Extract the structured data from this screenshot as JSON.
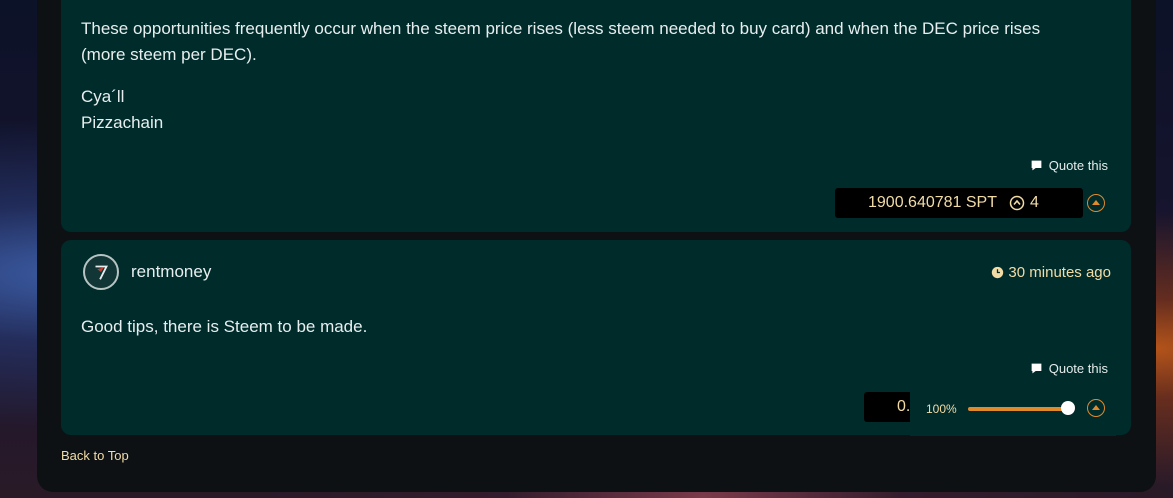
{
  "post1": {
    "paragraph": "These opportunities frequently occur when the steem price rises (less steem needed to buy card) and when the DEC price rises (more steem per DEC).",
    "signoff_line1": "Cya´ll",
    "signoff_line2": "Pizzachain",
    "quote_label": "Quote this",
    "payout": "1900.640781 SPT",
    "votes": "4"
  },
  "post2": {
    "author": "rentmoney",
    "time": "30 minutes ago",
    "body": "Good tips, there is Steem to be made.",
    "quote_label": "Quote this",
    "payout_partial": "0."
  },
  "vote_slider": {
    "percent_label": "100%",
    "value": 1.0
  },
  "footer": {
    "back_to_top": "Back to Top"
  },
  "colors": {
    "card_bg": "#002b2b",
    "accent_orange": "#e08a2c",
    "accent_gold": "#f2dca6"
  },
  "icons": [
    "comment-icon",
    "upvote-icon",
    "clock-icon",
    "avatar-logo-icon"
  ]
}
